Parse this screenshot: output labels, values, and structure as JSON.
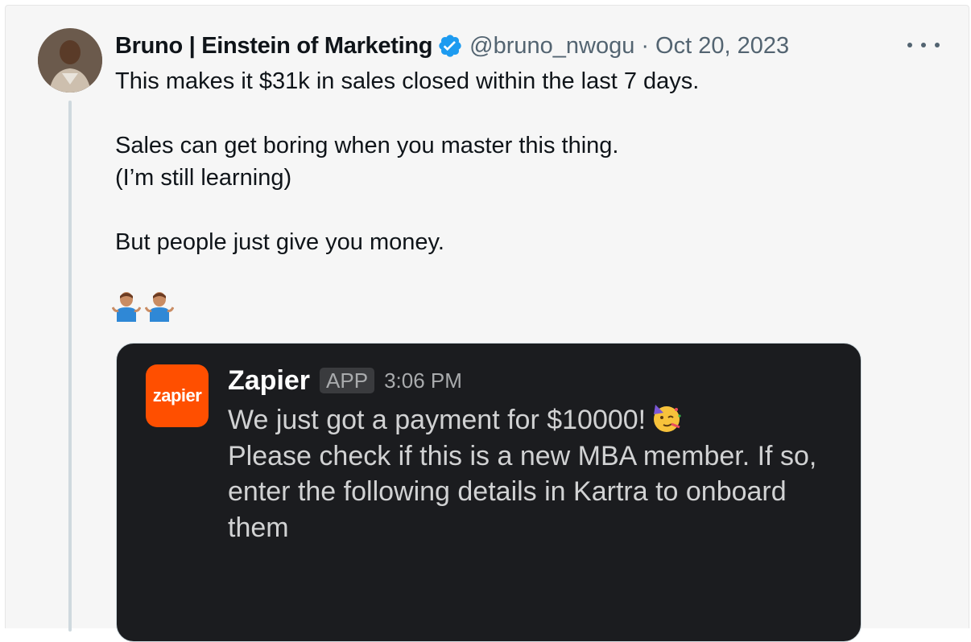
{
  "tweet": {
    "author_name": "Bruno | Einstein of Marketing",
    "handle": "@bruno_nwogu",
    "separator": "·",
    "date": "Oct 20, 2023",
    "lines": [
      "This makes it $31k in sales closed within the last 7 days.",
      "Sales can get boring when you master this thing.",
      "(I’m still learning)",
      "But people just give you money."
    ],
    "icons": [
      "verified-badge-icon",
      "more-options-icon",
      "person-shrugging-emoji",
      "person-shrugging-emoji"
    ]
  },
  "embed": {
    "logo_text": "zapier",
    "sender": "Zapier",
    "badge": "APP",
    "time": "3:06 PM",
    "message": "We just got a payment for $10000!",
    "message_rest": "Please check if this is a new MBA member. If so, enter the following details in Kartra to onboard them",
    "icons": [
      "partying-face-emoji"
    ]
  },
  "colors": {
    "verified": "#1d9bf0",
    "zapier_orange": "#ff4f00",
    "slack_bg": "#1b1c1f",
    "thread_line": "#cfd9de"
  }
}
